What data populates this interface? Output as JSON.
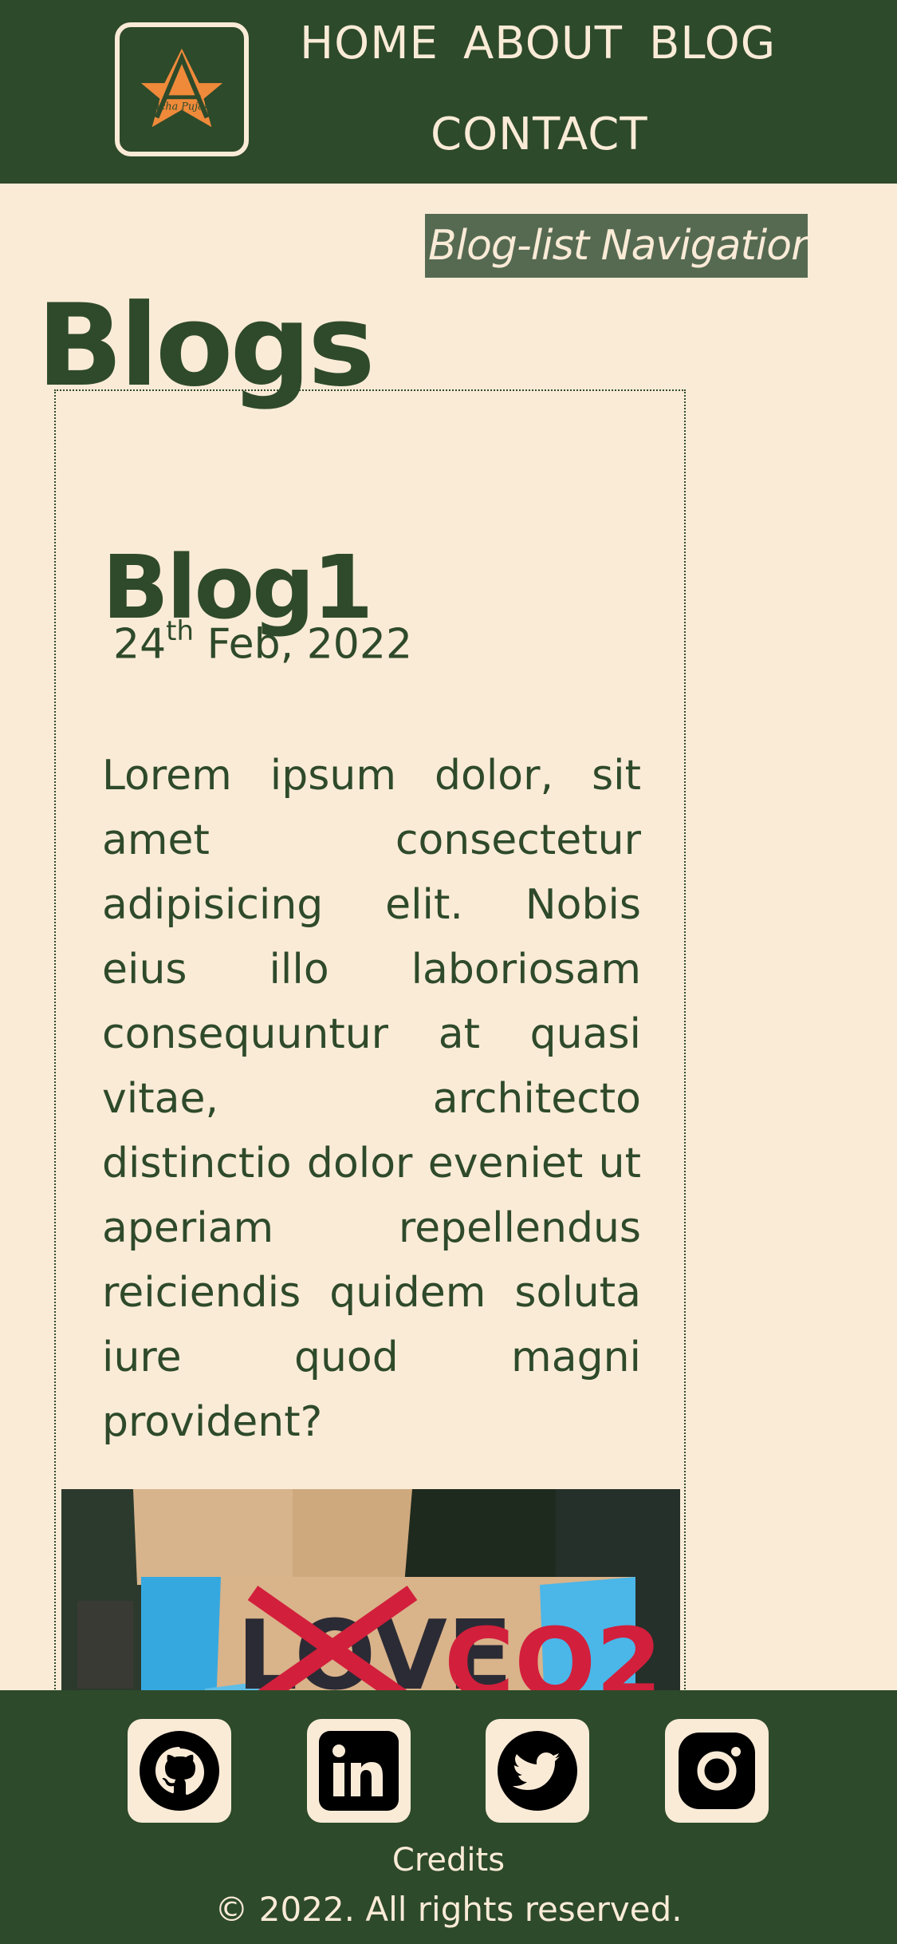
{
  "header": {
    "logo_text": "Richa Pujara",
    "nav": {
      "home": "HOME",
      "about": "ABOUT",
      "blog": "BLOG",
      "contact": "CONTACT"
    }
  },
  "main": {
    "title": "Blogs",
    "blog_list_nav": "Blog-list Navigation",
    "post": {
      "title": "Blog1",
      "date_day": "24",
      "date_suffix": "th",
      "date_rest": " Feb, 2022",
      "body": "Lorem ipsum dolor, sit amet consectetur adipisicing elit. Nobis eius illo laboriosam consequuntur at quasi vitae, architecto distinctio dolor eveniet ut aperiam repellendus reiciendis quidem soluta iure quod magni provident?",
      "image_sign_words": [
        "LOVE",
        "CO2"
      ]
    }
  },
  "footer": {
    "social": [
      "github-icon",
      "linkedin-icon",
      "twitter-icon",
      "instagram-icon"
    ],
    "credits": "Credits",
    "copyright": "© 2022. All rights reserved."
  },
  "colors": {
    "primary": "#2d4a2a",
    "background": "#faebd7",
    "accent": "#ef8a3a",
    "nav_badge": "#566a52"
  }
}
